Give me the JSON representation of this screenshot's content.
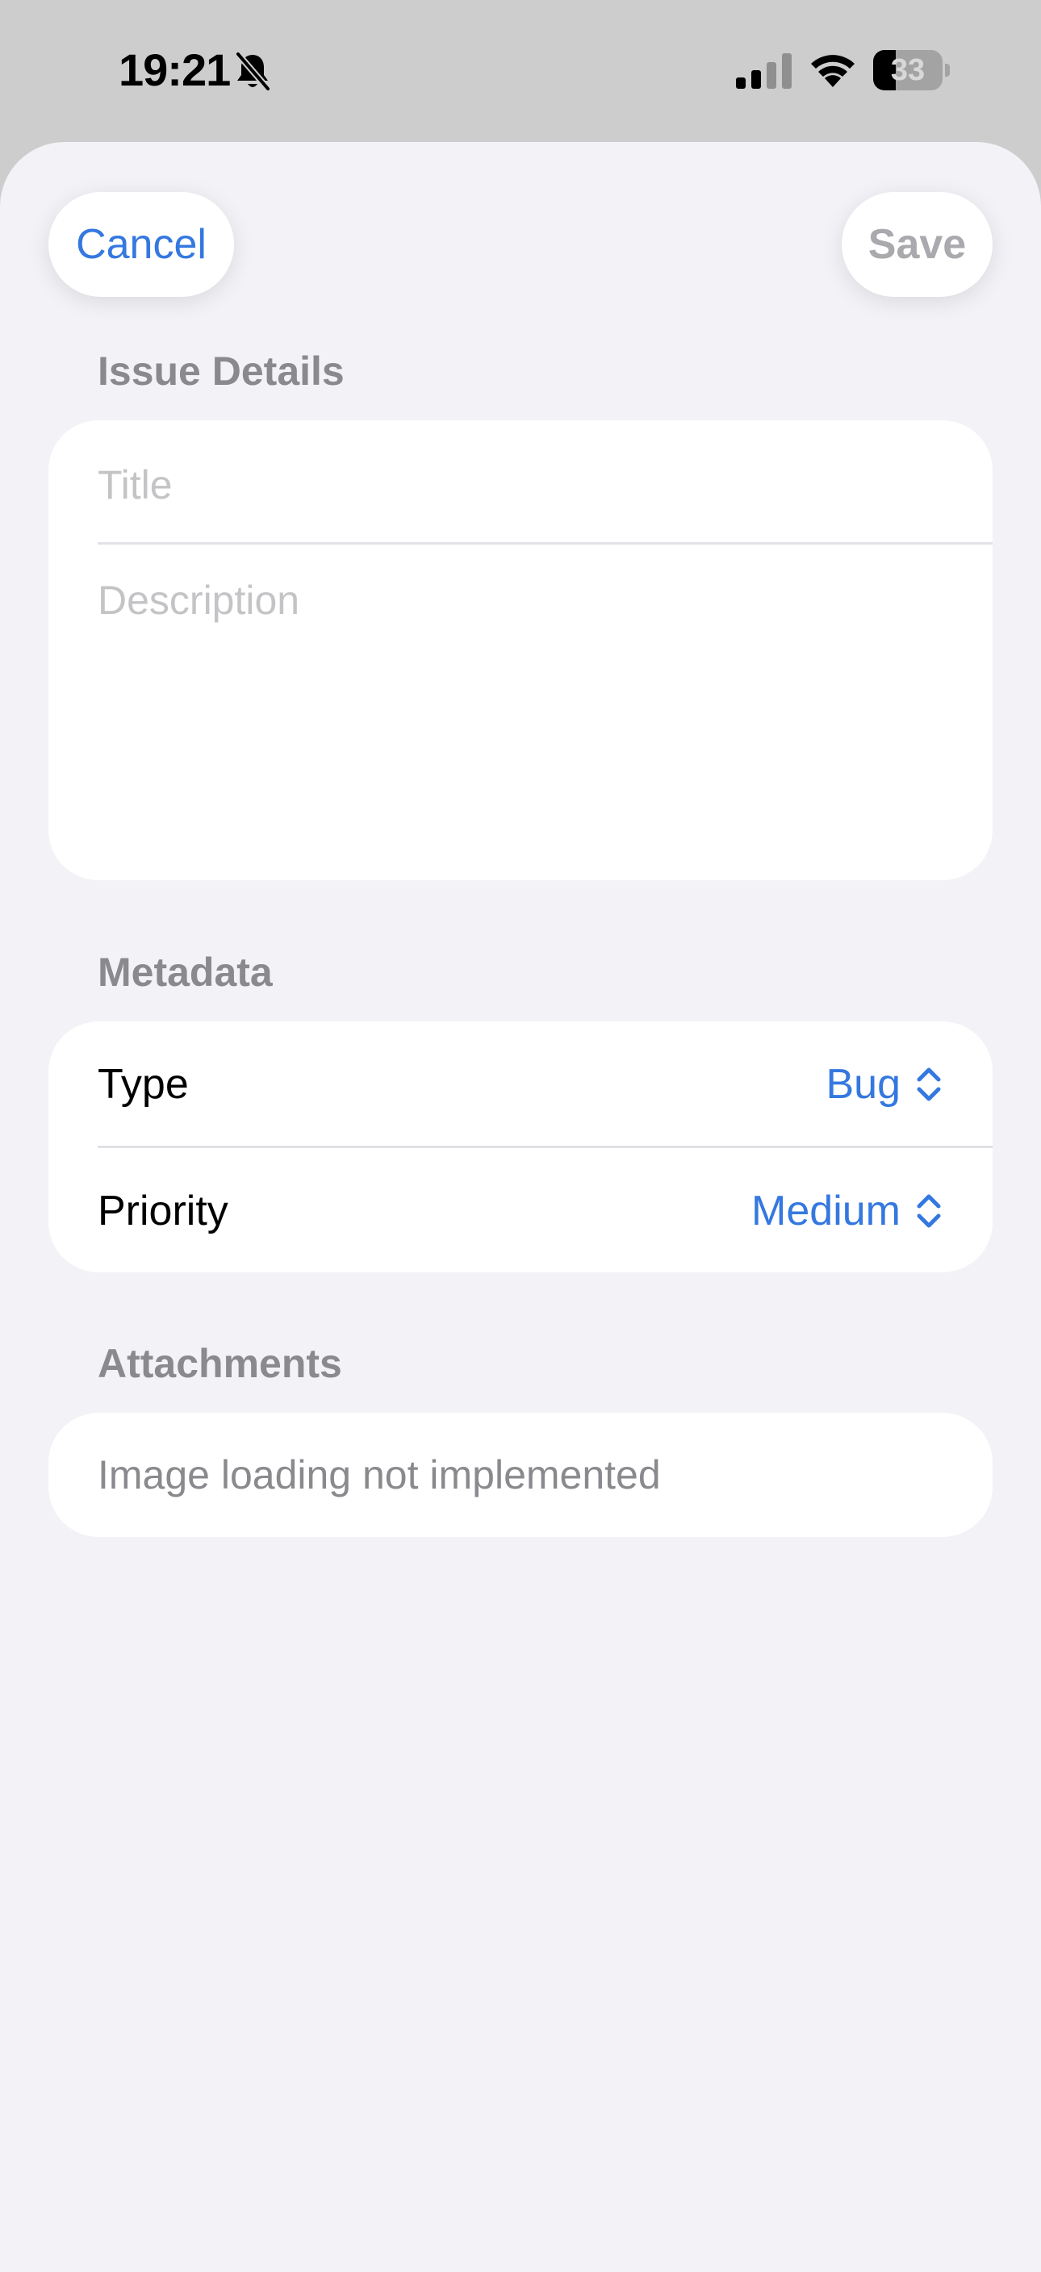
{
  "status_bar": {
    "time": "19:21",
    "battery_level": "33",
    "battery_fraction": 0.33,
    "silent_mode_icon": "bell-slash-icon",
    "signal_icon": "cellular-signal-icon",
    "wifi_icon": "wifi-icon"
  },
  "nav": {
    "cancel_label": "Cancel",
    "save_label": "Save"
  },
  "issue_details": {
    "header": "Issue Details",
    "title_value": "",
    "title_placeholder": "Title",
    "description_value": "",
    "description_placeholder": "Description"
  },
  "metadata": {
    "header": "Metadata",
    "type_label": "Type",
    "type_value": "Bug",
    "priority_label": "Priority",
    "priority_value": "Medium"
  },
  "attachments": {
    "header": "Attachments",
    "message": "Image loading not implemented"
  },
  "colors": {
    "accent": "#3478e0",
    "background": "#f2f2f7",
    "secondary_text": "#8a8a8e",
    "disabled_text": "#a9a9ae"
  }
}
